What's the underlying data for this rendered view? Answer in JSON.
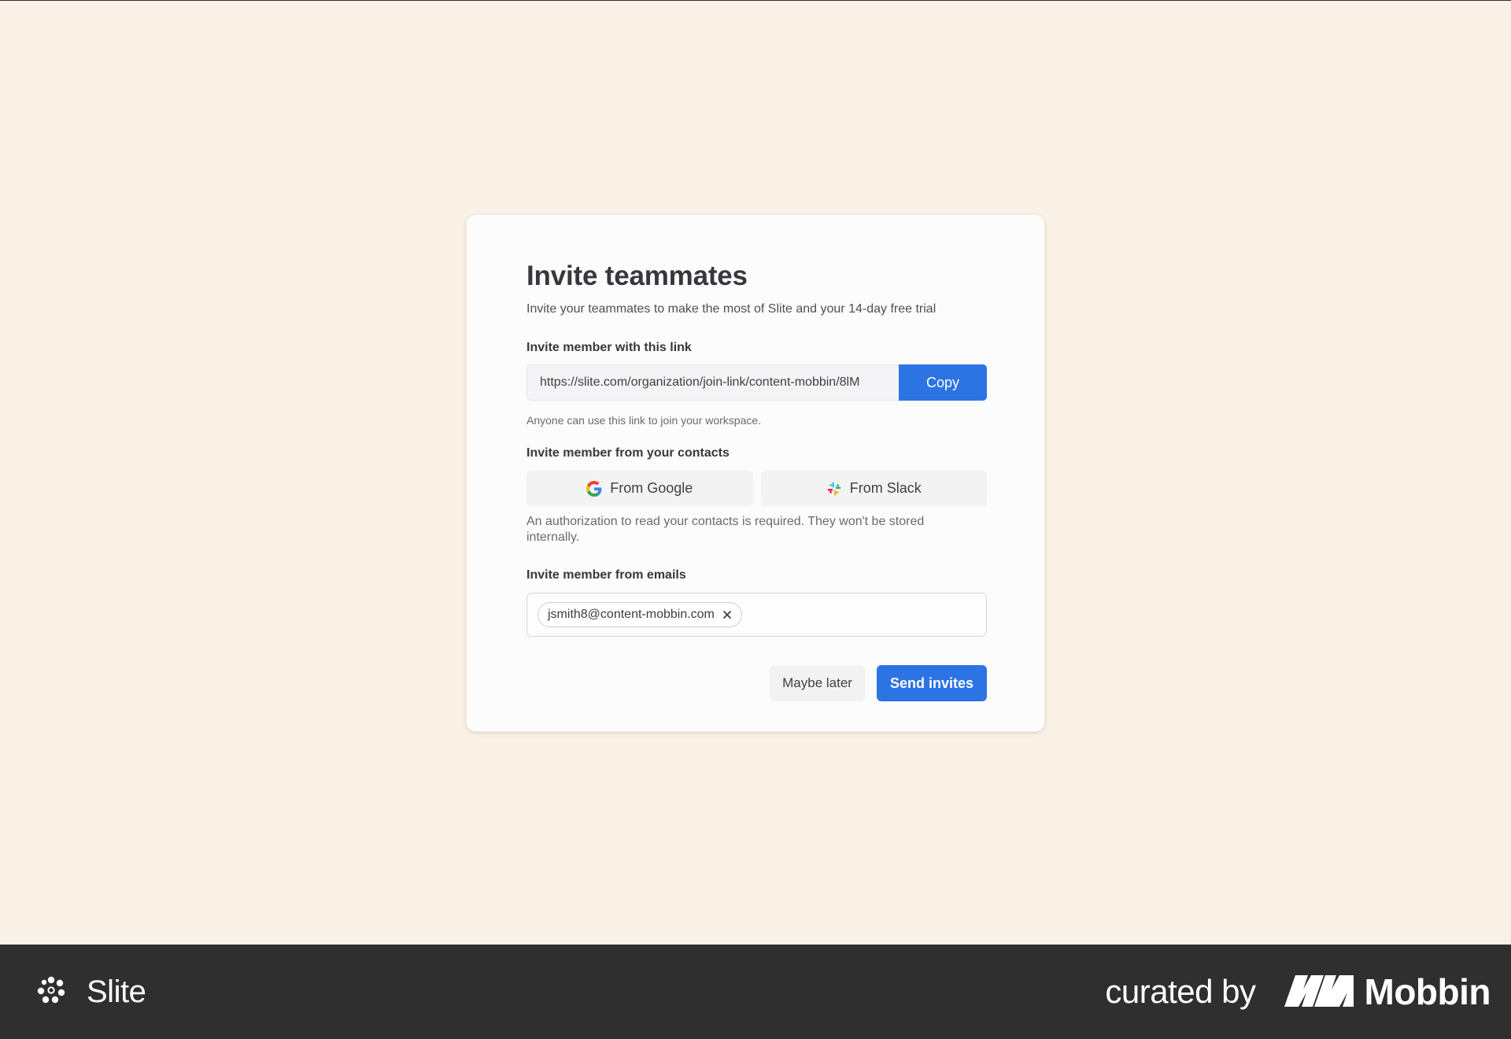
{
  "dialog": {
    "title": "Invite teammates",
    "subtitle": "Invite your teammates to make the most of Slite and your 14-day free trial",
    "link_section": {
      "label": "Invite member with this link",
      "link_value": "https://slite.com/organization/join-link/content-mobbin/8lM",
      "copy_label": "Copy",
      "help": "Anyone can use this link to join your workspace."
    },
    "contacts_section": {
      "label": "Invite member from your contacts",
      "google_label": "From Google",
      "slack_label": "From Slack",
      "help": "An authorization to read your contacts is required. They won't be stored internally."
    },
    "emails_section": {
      "label": "Invite member from emails",
      "emails": [
        "jsmith8@content-mobbin.com"
      ]
    },
    "actions": {
      "maybe_later": "Maybe later",
      "send_invites": "Send invites"
    }
  },
  "footer": {
    "app_name": "Slite",
    "curated_by": "curated by",
    "curator": "Mobbin"
  },
  "colors": {
    "background": "#f9f0e6",
    "accent": "#2c73e3",
    "footer": "#2f2f2f"
  },
  "icons": {
    "google": "google-icon",
    "slack": "slack-icon",
    "remove": "close-icon",
    "slite_logo": "slite-logo-icon",
    "mobbin_logo": "mobbin-logo-icon"
  }
}
